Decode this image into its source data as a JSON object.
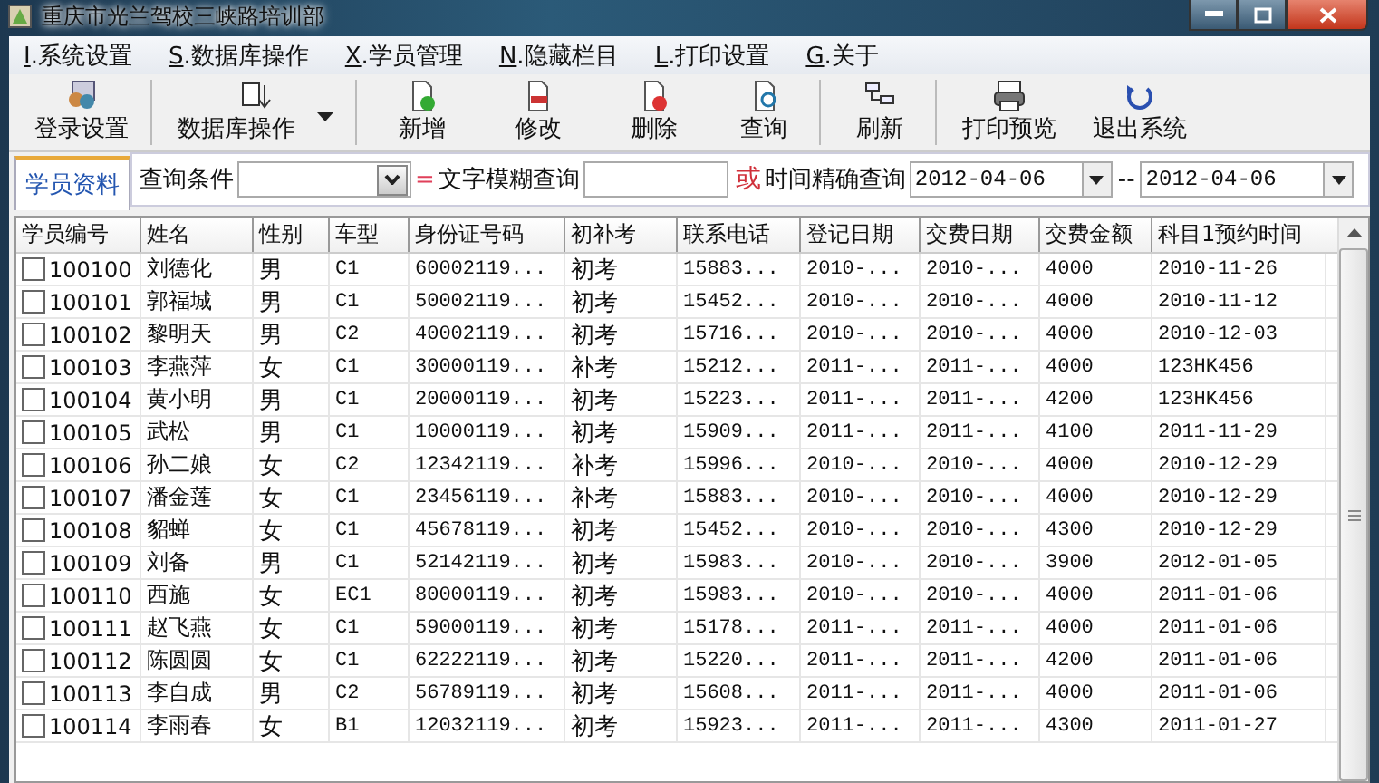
{
  "window": {
    "title": "重庆市光兰驾校三峡路培训部"
  },
  "menu": [
    {
      "label": "I.系统设置"
    },
    {
      "label": "S.数据库操作"
    },
    {
      "label": "X.学员管理"
    },
    {
      "label": "N.隐藏栏目"
    },
    {
      "label": "L.打印设置"
    },
    {
      "label": "G.关于"
    }
  ],
  "toolbar": [
    {
      "label": "登录设置",
      "separator_after": true,
      "dropdown": false
    },
    {
      "label": "数据库操作",
      "separator_after": true,
      "dropdown": true
    },
    {
      "label": "新增",
      "separator_after": false,
      "dropdown": false
    },
    {
      "label": "修改",
      "separator_after": false,
      "dropdown": false
    },
    {
      "label": "删除",
      "separator_after": false,
      "dropdown": false
    },
    {
      "label": "查询",
      "separator_after": true,
      "dropdown": false
    },
    {
      "label": "刷新",
      "separator_after": true,
      "dropdown": false
    },
    {
      "label": "打印预览",
      "separator_after": false,
      "dropdown": false
    },
    {
      "label": "退出系统",
      "separator_after": false,
      "dropdown": false
    }
  ],
  "tabs": [
    {
      "label": "学员资料",
      "selected": true
    }
  ],
  "search": {
    "condition_label": "查询条件",
    "fuzzy_operator": "=",
    "fuzzy_label": "文字模糊查询",
    "or_label": "或",
    "exact_label": "时间精确查询",
    "date_from": "2012-04-06",
    "range_separator": "--",
    "date_to": "2012-04-06"
  },
  "table": {
    "columns": [
      "学员编号",
      "姓名",
      "性别",
      "车型",
      "身份证号码",
      "初补考",
      "联系电话",
      "登记日期",
      "交费日期",
      "交费金额",
      "科目1预约时间"
    ],
    "rows": [
      {
        "checked": false,
        "cells": [
          "100100",
          "刘德化",
          "男",
          "C1",
          "60002119...",
          "初考",
          "15883...",
          "2010-...",
          "2010-...",
          "4000",
          "2010-11-26"
        ]
      },
      {
        "checked": false,
        "cells": [
          "100101",
          "郭福城",
          "男",
          "C1",
          "50002119...",
          "初考",
          "15452...",
          "2010-...",
          "2010-...",
          "4000",
          "2010-11-12"
        ]
      },
      {
        "checked": false,
        "cells": [
          "100102",
          "黎明天",
          "男",
          "C2",
          "40002119...",
          "初考",
          "15716...",
          "2010-...",
          "2010-...",
          "4000",
          "2010-12-03"
        ]
      },
      {
        "checked": false,
        "cells": [
          "100103",
          "李燕萍",
          "女",
          "C1",
          "30000119...",
          "补考",
          "15212...",
          "2011-...",
          "2011-...",
          "4000",
          "123HK456"
        ]
      },
      {
        "checked": false,
        "cells": [
          "100104",
          "黄小明",
          "男",
          "C1",
          "20000119...",
          "初考",
          "15223...",
          "2011-...",
          "2011-...",
          "4200",
          "123HK456"
        ]
      },
      {
        "checked": false,
        "cells": [
          "100105",
          "武松",
          "男",
          "C1",
          "10000119...",
          "初考",
          "15909...",
          "2011-...",
          "2011-...",
          "4100",
          "2011-11-29"
        ]
      },
      {
        "checked": false,
        "cells": [
          "100106",
          "孙二娘",
          "女",
          "C2",
          "12342119...",
          "补考",
          "15996...",
          "2010-...",
          "2010-...",
          "4000",
          "2010-12-29"
        ]
      },
      {
        "checked": false,
        "cells": [
          "100107",
          "潘金莲",
          "女",
          "C1",
          "23456119...",
          "补考",
          "15883...",
          "2010-...",
          "2010-...",
          "4000",
          "2010-12-29"
        ]
      },
      {
        "checked": false,
        "cells": [
          "100108",
          "貂蝉",
          "女",
          "C1",
          "45678119...",
          "初考",
          "15452...",
          "2010-...",
          "2010-...",
          "4300",
          "2010-12-29"
        ]
      },
      {
        "checked": false,
        "cells": [
          "100109",
          "刘备",
          "男",
          "C1",
          "52142119...",
          "初考",
          "15983...",
          "2010-...",
          "2010-...",
          "3900",
          "2012-01-05"
        ]
      },
      {
        "checked": false,
        "cells": [
          "100110",
          "西施",
          "女",
          "EC1",
          "80000119...",
          "初考",
          "15983...",
          "2010-...",
          "2010-...",
          "4000",
          "2011-01-06"
        ]
      },
      {
        "checked": false,
        "cells": [
          "100111",
          "赵飞燕",
          "女",
          "C1",
          "59000119...",
          "初考",
          "15178...",
          "2011-...",
          "2011-...",
          "4000",
          "2011-01-06"
        ]
      },
      {
        "checked": false,
        "cells": [
          "100112",
          "陈圆圆",
          "女",
          "C1",
          "62222119...",
          "初考",
          "15220...",
          "2011-...",
          "2011-...",
          "4200",
          "2011-01-06"
        ]
      },
      {
        "checked": false,
        "cells": [
          "100113",
          "李自成",
          "男",
          "C2",
          "56789119...",
          "初考",
          "15608...",
          "2011-...",
          "2011-...",
          "4000",
          "2011-01-06"
        ]
      },
      {
        "checked": false,
        "cells": [
          "100114",
          "李雨春",
          "女",
          "B1",
          "12032119...",
          "初考",
          "15923...",
          "2011-...",
          "2011-...",
          "4300",
          "2011-01-27"
        ]
      }
    ]
  }
}
